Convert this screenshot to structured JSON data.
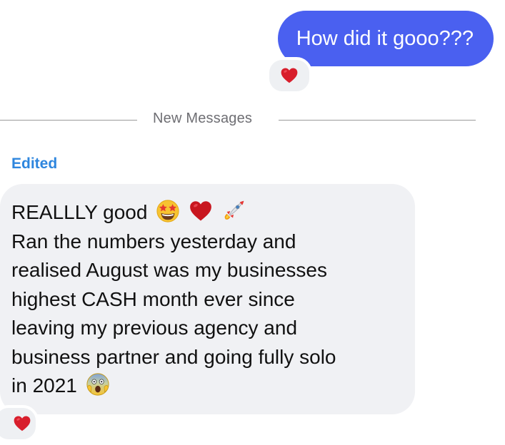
{
  "thread": {
    "outgoing_message": {
      "text": "How did it gooo???",
      "reaction": "heart-icon"
    },
    "divider": {
      "label": "New Messages"
    },
    "incoming_message": {
      "edited_label": "Edited",
      "lines": [
        "REALLLY good",
        "Ran the numbers yesterday and",
        "realised August was my businesses",
        "highest CASH month ever since",
        "leaving my previous agency and",
        "business partner and going fully solo",
        "in 2021"
      ],
      "inline_emojis": [
        "star-struck-emoji",
        "red-heart-emoji",
        "rocket-emoji",
        "screaming-face-emoji"
      ],
      "reaction": "heart-icon"
    }
  },
  "colors": {
    "outgoing_bubble": "#4a60f0",
    "incoming_bubble": "#f0f1f4",
    "edited_label": "#2e86de",
    "divider_text": "#6e6e73",
    "heart": "#d81e2c"
  }
}
